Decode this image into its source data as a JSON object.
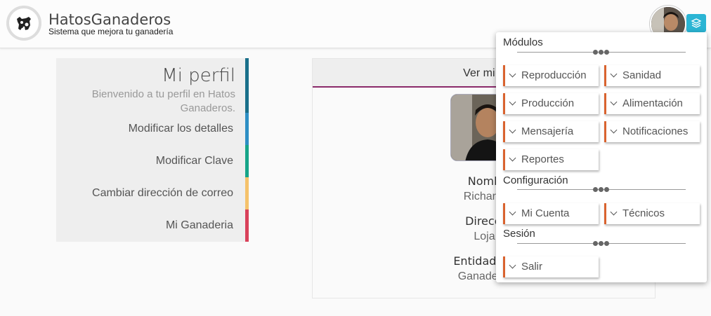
{
  "header": {
    "brand_title": "HatosGanaderos",
    "brand_subtitle": "Sistema que mejora tu ganadería",
    "logo_icon": "cow-icon",
    "accent": "#2bb5d4"
  },
  "profile_menu": {
    "title": "Mi perfil",
    "welcome": "Bienvenido a tu perfil en Hatos Ganaderos.",
    "items": [
      {
        "label": "Modificar los detalles",
        "color": "#2e8fc4"
      },
      {
        "label": "Modificar Clave",
        "color": "#17a589"
      },
      {
        "label": "Cambiar dirección de correo",
        "color": "#f5c26b"
      },
      {
        "label": "Mi Ganaderia",
        "color": "#d9415a"
      }
    ]
  },
  "profile_card": {
    "header": "Ver mi p",
    "fields": [
      {
        "label": "Nomb",
        "value": "Richar L"
      },
      {
        "label": "Direcci",
        "value": "Loja"
      },
      {
        "label": "Entidad Ga",
        "value": "Ganadería"
      }
    ]
  },
  "dropdown": {
    "sections": [
      {
        "title": "Módulos",
        "items": [
          "Reproducción",
          "Sanidad",
          "Producción",
          "Alimentación",
          "Mensajería",
          "Notificaciones",
          "Reportes"
        ]
      },
      {
        "title": "Configuración",
        "items": [
          "Mi Cuenta",
          "Técnicos"
        ]
      },
      {
        "title": "Sesión",
        "items": [
          "Salir"
        ]
      }
    ],
    "button_accent": "#d9632f"
  }
}
